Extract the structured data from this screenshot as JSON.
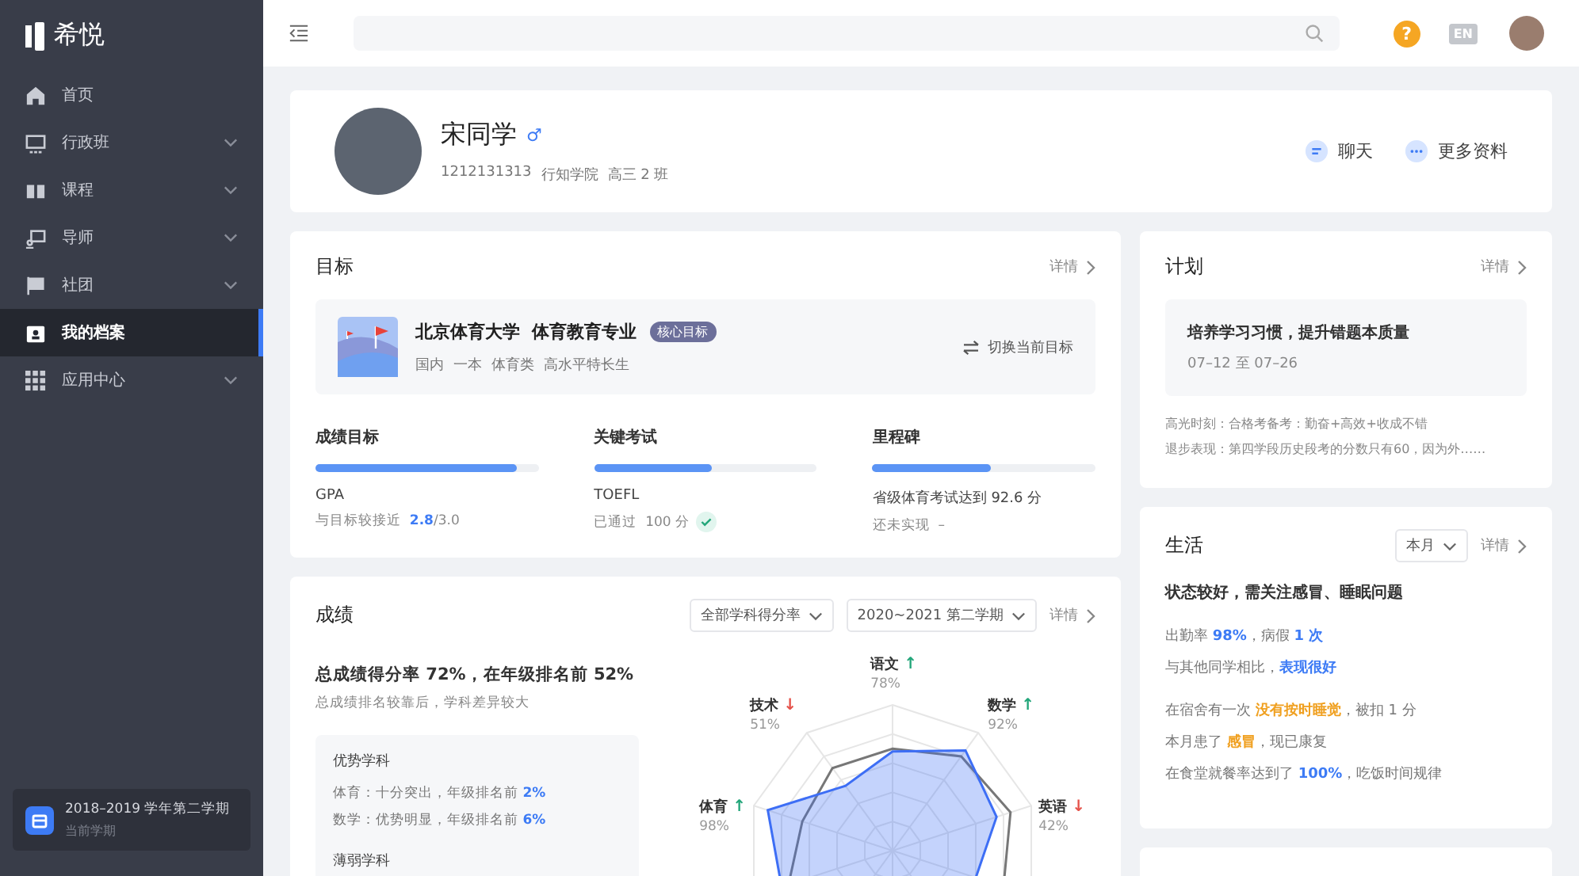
{
  "brand": {
    "name": "希悦"
  },
  "sidebar": {
    "items": [
      {
        "label": "首页",
        "expandable": false,
        "selected": false
      },
      {
        "label": "行政班",
        "expandable": true,
        "selected": false
      },
      {
        "label": "课程",
        "expandable": true,
        "selected": false
      },
      {
        "label": "导师",
        "expandable": true,
        "selected": false
      },
      {
        "label": "社团",
        "expandable": true,
        "selected": false
      },
      {
        "label": "我的档案",
        "expandable": false,
        "selected": true
      },
      {
        "label": "应用中心",
        "expandable": true,
        "selected": false
      }
    ],
    "term": {
      "title": "2018–2019 学年第二学期",
      "subtitle": "当前学期"
    }
  },
  "topbar": {
    "help": "?",
    "lang": "EN"
  },
  "profile": {
    "name": "宋同学",
    "gender_symbol": "♂",
    "id": "1212131313",
    "school": "行知学院",
    "class": "高三 2 班",
    "actions": [
      "聊天",
      "更多资料"
    ]
  },
  "goal": {
    "title": "目标",
    "detail": "详情",
    "target": {
      "name": "北京体育大学  体育教育专业",
      "badge": "核心目标",
      "tags": [
        "国内",
        "一本",
        "体育类",
        "高水平特长生"
      ],
      "switch": "切换当前目标"
    },
    "metrics": [
      {
        "title": "成绩目标",
        "level": 0.9,
        "name": "GPA",
        "note": [
          {
            "text": "与目标较接近  "
          },
          {
            "text": "2.8",
            "color": "#3d7bf5"
          },
          {
            "text": "/3.0"
          }
        ],
        "done": false
      },
      {
        "title": "关键考试",
        "level": 0.53,
        "name": "TOEFL",
        "note": [
          {
            "text": "已通过  100 分"
          }
        ],
        "done": true
      },
      {
        "title": "里程碑",
        "level": 0.53,
        "name": "省级体育考试达到 92.6 分",
        "note": [
          {
            "text": "还未实现  –"
          }
        ],
        "done": false
      }
    ]
  },
  "grades": {
    "title": "成绩",
    "filters": [
      "全部学科得分率",
      "2020~2021 第二学期"
    ],
    "detail": "详情",
    "summary": "总成绩得分率 72%，在年级排名前 52%",
    "comment": "总成绩排名较靠后，学科差异较大",
    "strong": {
      "title": "优势学科",
      "lines": [
        [
          {
            "text": "体育：十分突出，年级排名前 "
          },
          {
            "text": "2%",
            "color": "#3d7bf5"
          }
        ],
        [
          {
            "text": "数学：优势明显，年级排名前 "
          },
          {
            "text": "6%",
            "color": "#3d7bf5"
          }
        ]
      ]
    },
    "weak": {
      "title": "薄弱学科"
    },
    "radar": [
      {
        "subject": "语文",
        "trend": "↑",
        "color": "#23a67a",
        "rate": "78%"
      },
      {
        "subject": "技术",
        "trend": "↓",
        "color": "#e5534b",
        "rate": "51%"
      },
      {
        "subject": "数学",
        "trend": "↑",
        "color": "#23a67a",
        "rate": "92%"
      },
      {
        "subject": "体育",
        "trend": "↑",
        "color": "#23a67a",
        "rate": "98%"
      },
      {
        "subject": "英语",
        "trend": "↓",
        "color": "#e5534b",
        "rate": "42%"
      }
    ]
  },
  "plan": {
    "title": "计划",
    "detail": "详情",
    "item": {
      "title": "培养学习习惯，提升错题本质量",
      "dates": "07–12 至 07–26"
    },
    "notes": [
      "高光时刻：合格考备考：勤奋+高效+收成不错",
      "退步表现：第四学段历史段考的分数只有60，因为外……"
    ]
  },
  "life": {
    "title": "生活",
    "filter": "本月",
    "detail": "详情",
    "summary": "状态较好，需关注感冒、睡眠问题",
    "groups": [
      [
        [
          {
            "text": "出勤率 "
          },
          {
            "text": "98%",
            "color": "#3d7bf5"
          },
          {
            "text": "，病假 "
          },
          {
            "text": "1 次",
            "color": "#3d7bf5"
          }
        ],
        [
          {
            "text": "与其他同学相比，"
          },
          {
            "text": "表现很好",
            "color": "#3d7bf5"
          }
        ]
      ],
      [
        [
          {
            "text": "在宿舍有一次 "
          },
          {
            "text": "没有按时睡觉",
            "color": "#f0a020"
          },
          {
            "text": "，被扣 1 分"
          }
        ],
        [
          {
            "text": "本月患了 "
          },
          {
            "text": "感冒",
            "color": "#f0a020"
          },
          {
            "text": "，现已康复"
          }
        ],
        [
          {
            "text": "在食堂就餐率达到了 "
          },
          {
            "text": "100%",
            "color": "#3d7bf5"
          },
          {
            "text": "，吃饭时间规律"
          }
        ]
      ]
    ]
  }
}
